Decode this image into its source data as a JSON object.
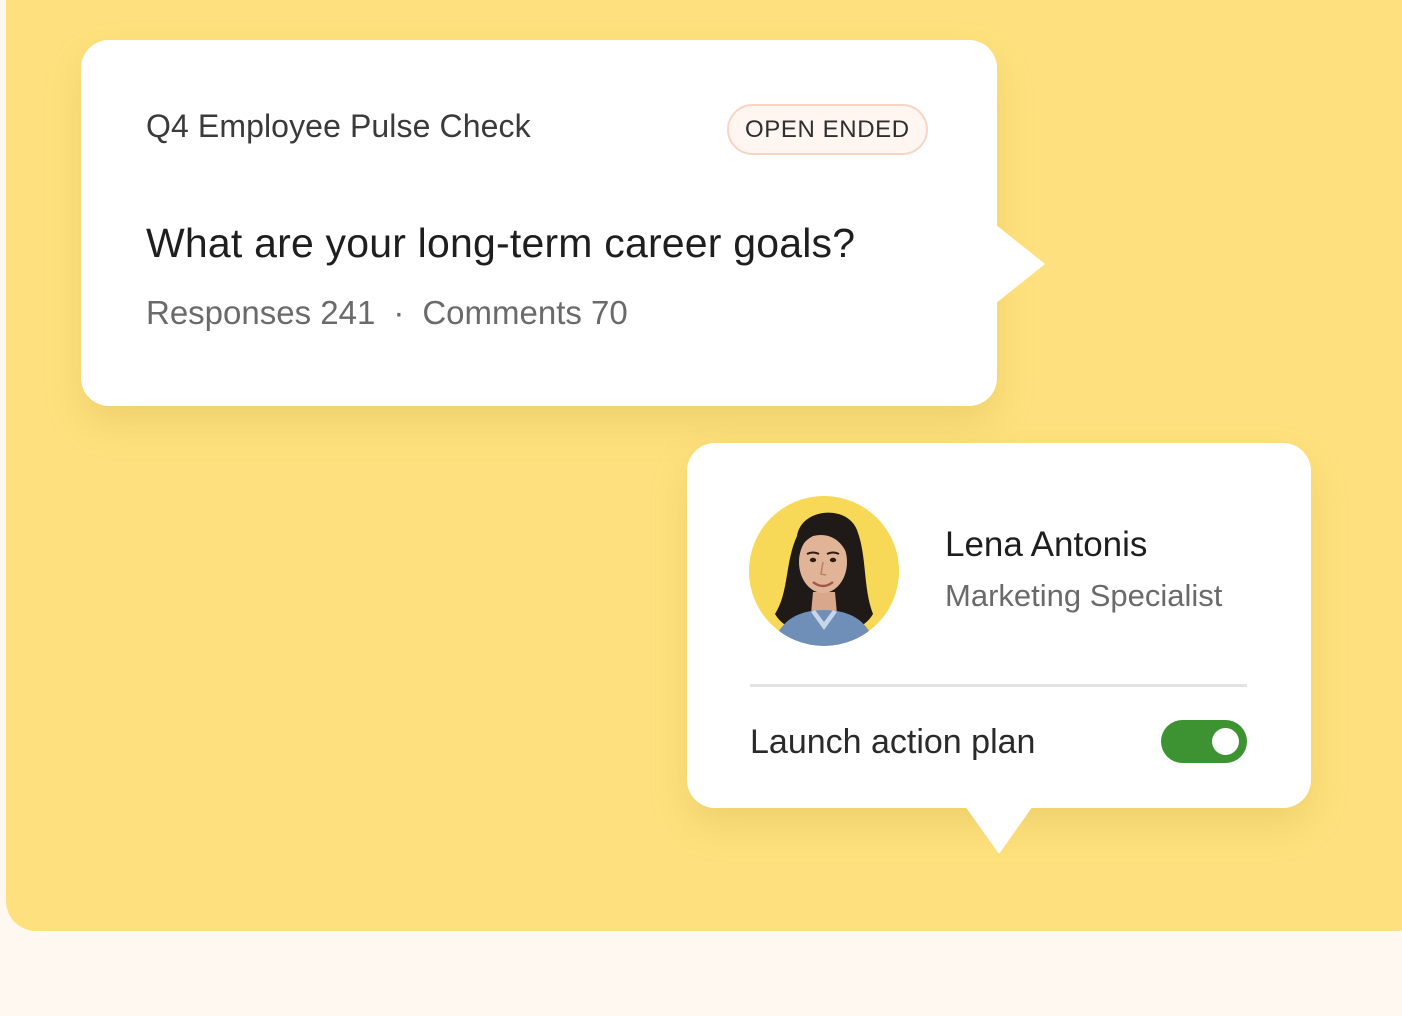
{
  "survey": {
    "title": "Q4 Employee Pulse Check",
    "badge": "OPEN ENDED",
    "question": "What are your long-term career goals?",
    "responses_label": "Responses 241",
    "separator": "·",
    "comments_label": "Comments 70"
  },
  "person": {
    "name": "Lena Antonis",
    "role": "Marketing Specialist",
    "avatar_icon": "person-photo-icon",
    "action_label": "Launch action plan",
    "toggle_on": true
  },
  "colors": {
    "panel": "#fee17e",
    "page": "#fff8f1",
    "toggle": "#3d9231",
    "badge_border": "#f6d5c4"
  }
}
